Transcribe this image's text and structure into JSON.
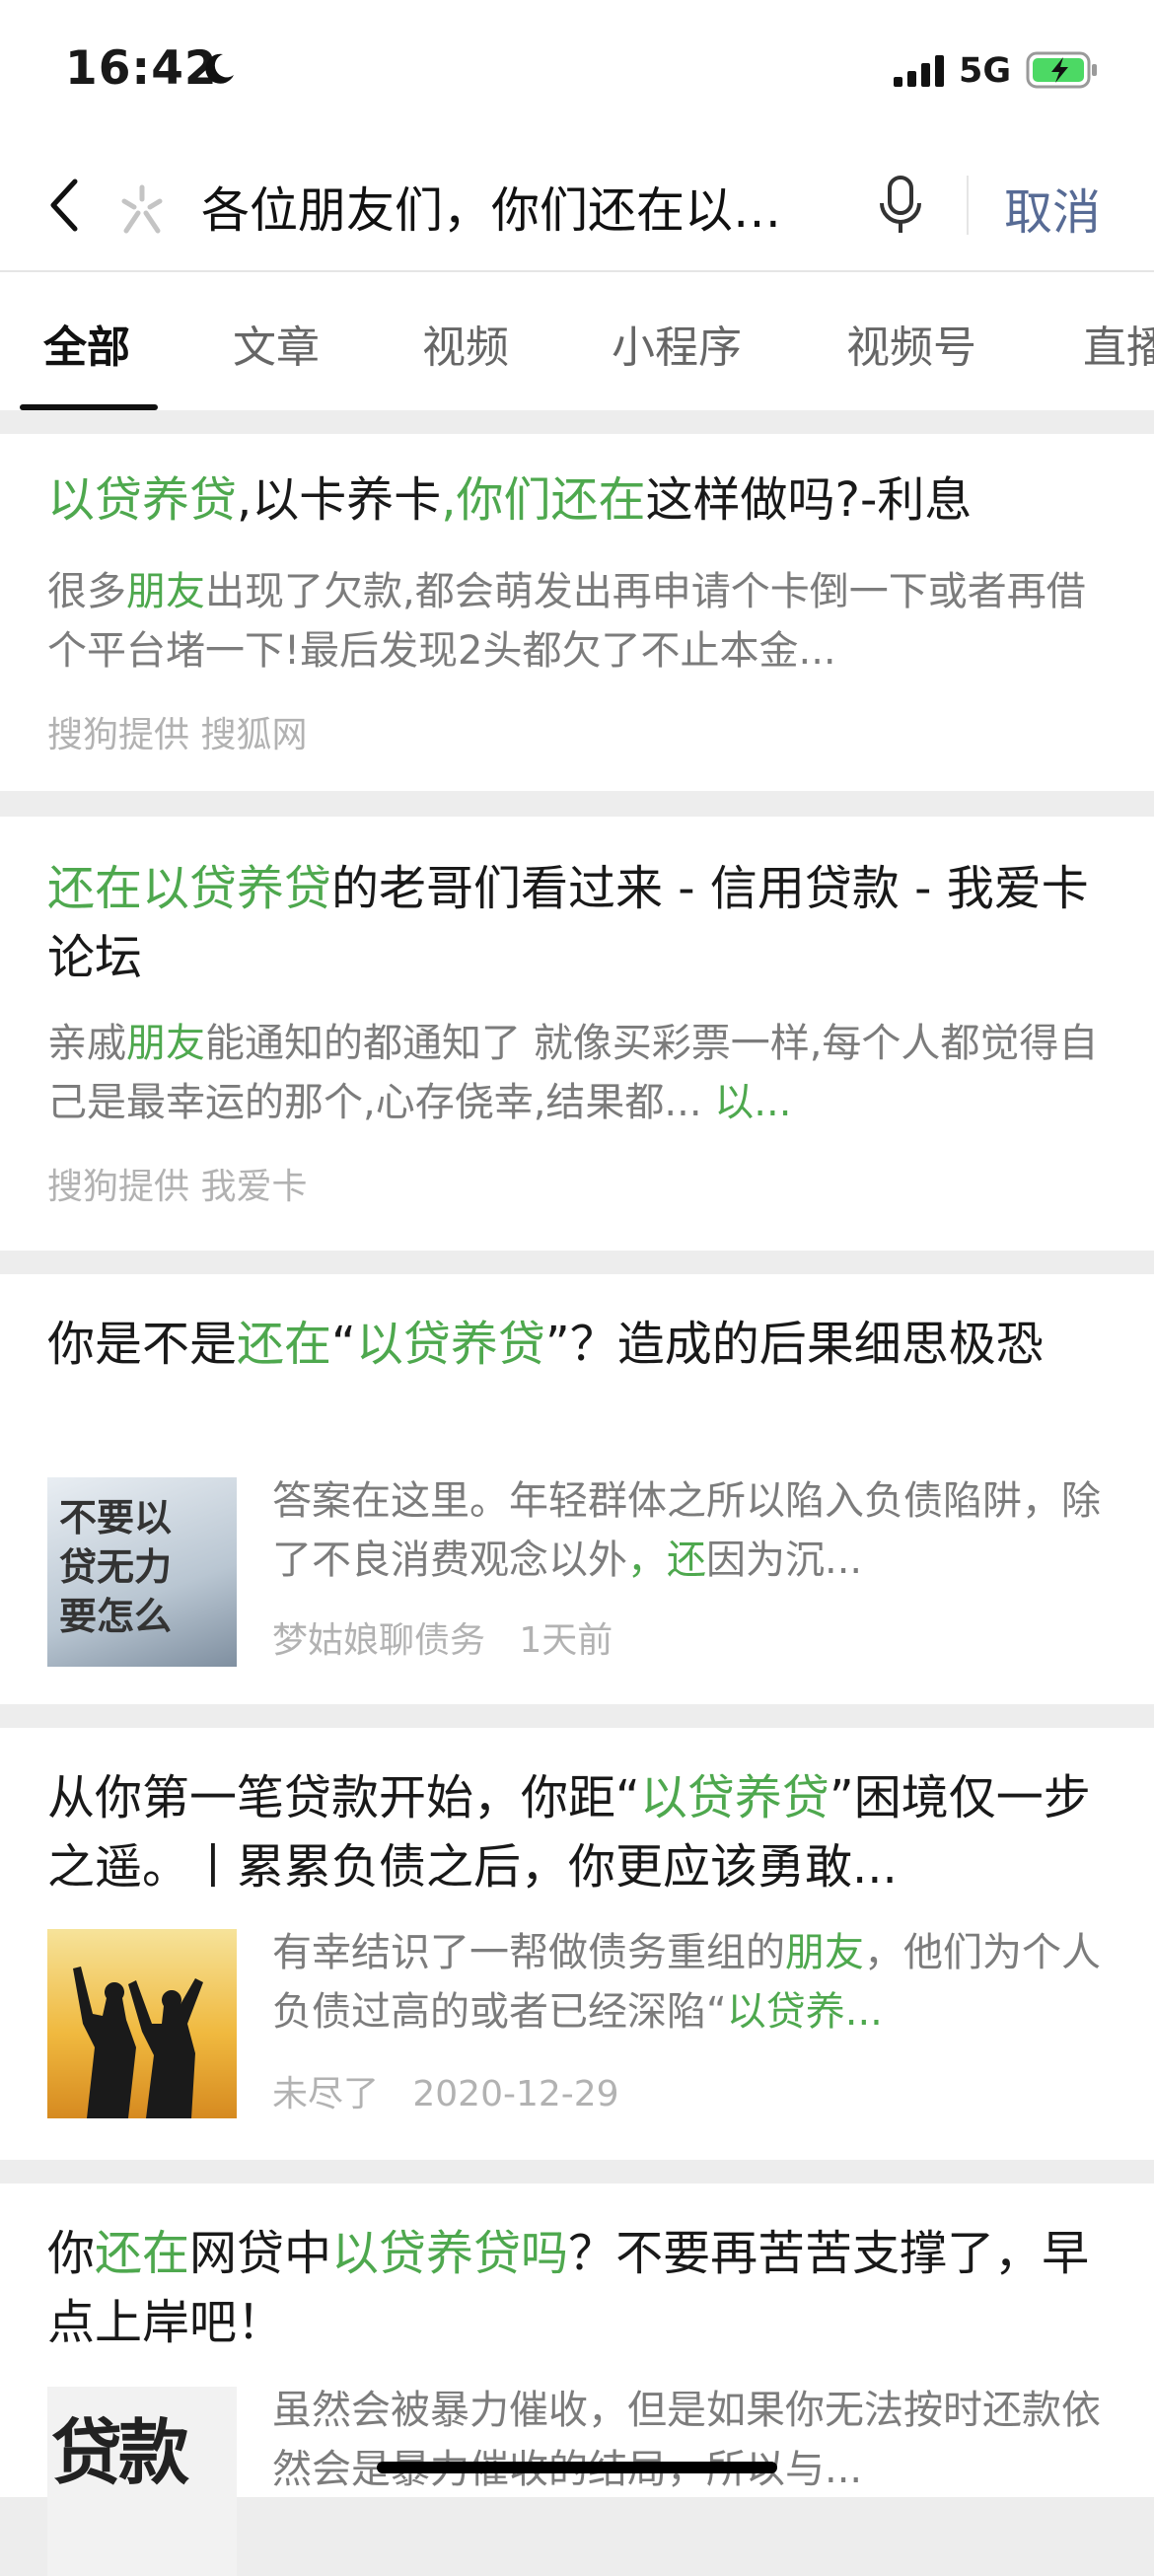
{
  "status_bar": {
    "time": "16:42",
    "network": "5G"
  },
  "search": {
    "query": "各位朋友们，你们还在以…",
    "cancel_label": "取消"
  },
  "tabs": [
    {
      "label": "全部",
      "active": true
    },
    {
      "label": "文章"
    },
    {
      "label": "视频"
    },
    {
      "label": "小程序"
    },
    {
      "label": "视频号"
    },
    {
      "label": "直播"
    }
  ],
  "results": [
    {
      "title": [
        {
          "t": "以贷养贷",
          "hl": true
        },
        {
          "t": ",以卡养卡"
        },
        {
          "t": ",你们还在",
          "hl": true
        },
        {
          "t": "这样做吗?-利息"
        }
      ],
      "desc": [
        {
          "t": "很多"
        },
        {
          "t": "朋友",
          "hl": true
        },
        {
          "t": "出现了欠款,都会萌发出再申请个卡倒一下或者再借个平台堵一下!最后发现2头都欠了不止本金..."
        }
      ],
      "meta": "搜狗提供 搜狐网"
    },
    {
      "title": [
        {
          "t": "还在以贷养贷",
          "hl": true
        },
        {
          "t": "的老哥们看过来 - 信用贷款 - 我爱卡论坛"
        }
      ],
      "desc": [
        {
          "t": "亲戚"
        },
        {
          "t": "朋友",
          "hl": true
        },
        {
          "t": "能通知的都通知了 就像买彩票一样,每个人都觉得自己是最幸运的那个,心存侥幸,结果都... "
        },
        {
          "t": "以...",
          "hl": true
        }
      ],
      "meta": "搜狗提供 我爱卡"
    },
    {
      "title": [
        {
          "t": "你是不是"
        },
        {
          "t": "还在",
          "hl": true
        },
        {
          "t": "“"
        },
        {
          "t": "以贷养贷",
          "hl": true
        },
        {
          "t": "”？造成的后果细思极恐"
        }
      ],
      "desc": [
        {
          "t": "答案在这里。年轻群体之所以陷入负债陷阱，除了不良消费观念以外"
        },
        {
          "t": "，还",
          "hl": true
        },
        {
          "t": "因为沉..."
        }
      ],
      "thumb_text": "不要以\n贷无力\n要怎么",
      "meta_author": "梦姑娘聊债务",
      "meta_time": "1天前"
    },
    {
      "title": [
        {
          "t": "从你第一笔贷款开始，你距“"
        },
        {
          "t": "以贷养贷",
          "hl": true
        },
        {
          "t": "”困境仅一步之遥。丨累累负债之后，你更应该勇敢..."
        }
      ],
      "desc": [
        {
          "t": "有幸结识了一帮做债务重组的"
        },
        {
          "t": "朋友",
          "hl": true
        },
        {
          "t": "，他们为个人负债过高的或者已经深陷“"
        },
        {
          "t": "以贷养...",
          "hl": true
        }
      ],
      "meta_author": "未尽了",
      "meta_time": "2020-12-29"
    },
    {
      "title": [
        {
          "t": "你"
        },
        {
          "t": "还在",
          "hl": true
        },
        {
          "t": "网贷中"
        },
        {
          "t": "以贷养贷吗",
          "hl": true
        },
        {
          "t": "？不要再苦苦支撑了，早点上岸吧！"
        }
      ],
      "desc": [
        {
          "t": "虽然会被暴力催收，但是如果你无法按时还款依然会是暴力催收的结局，所以与..."
        }
      ],
      "thumb_text": "贷款"
    }
  ]
}
